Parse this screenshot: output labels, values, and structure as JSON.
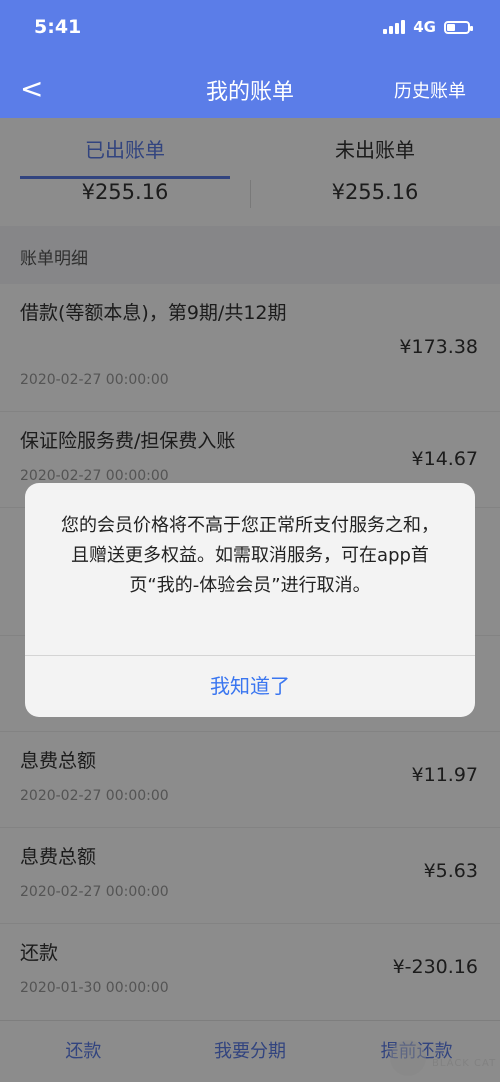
{
  "status": {
    "time": "5:41",
    "network": "4G"
  },
  "nav": {
    "back": "<",
    "title": "我的账单",
    "history": "历史账单"
  },
  "tabs": [
    {
      "label": "已出账单",
      "amount": "¥255.16",
      "active": true
    },
    {
      "label": "未出账单",
      "amount": "¥255.16",
      "active": false
    }
  ],
  "section_title": "账单明细",
  "rows": [
    {
      "name": "借款(等额本息)，第9期/共12期",
      "date": "2020-02-27 00:00:00",
      "amount": "¥173.38"
    },
    {
      "name": "保证险服务费/担保费入账",
      "date": "2020-02-27 00:00:00",
      "amount": "¥14.67"
    },
    {
      "name": "",
      "date": "",
      "amount": ""
    },
    {
      "name": "",
      "date": "",
      "amount": ""
    },
    {
      "name": "息费总额",
      "date": "2020-02-27 00:00:00",
      "amount": "¥11.97"
    },
    {
      "name": "息费总额",
      "date": "2020-02-27 00:00:00",
      "amount": "¥5.63"
    },
    {
      "name": "还款",
      "date": "2020-01-30 00:00:00",
      "amount": "¥-230.16"
    }
  ],
  "bottom": {
    "repay": "还款",
    "installment": "我要分期",
    "prepay": "提前还款"
  },
  "dialog": {
    "message": "您的会员价格将不高于您正常所支付服务之和，且赠送更多权益。如需取消服务，可在app首页“我的-体验会员”进行取消。",
    "ok": "我知道了"
  },
  "watermark": "BLACK CAT"
}
